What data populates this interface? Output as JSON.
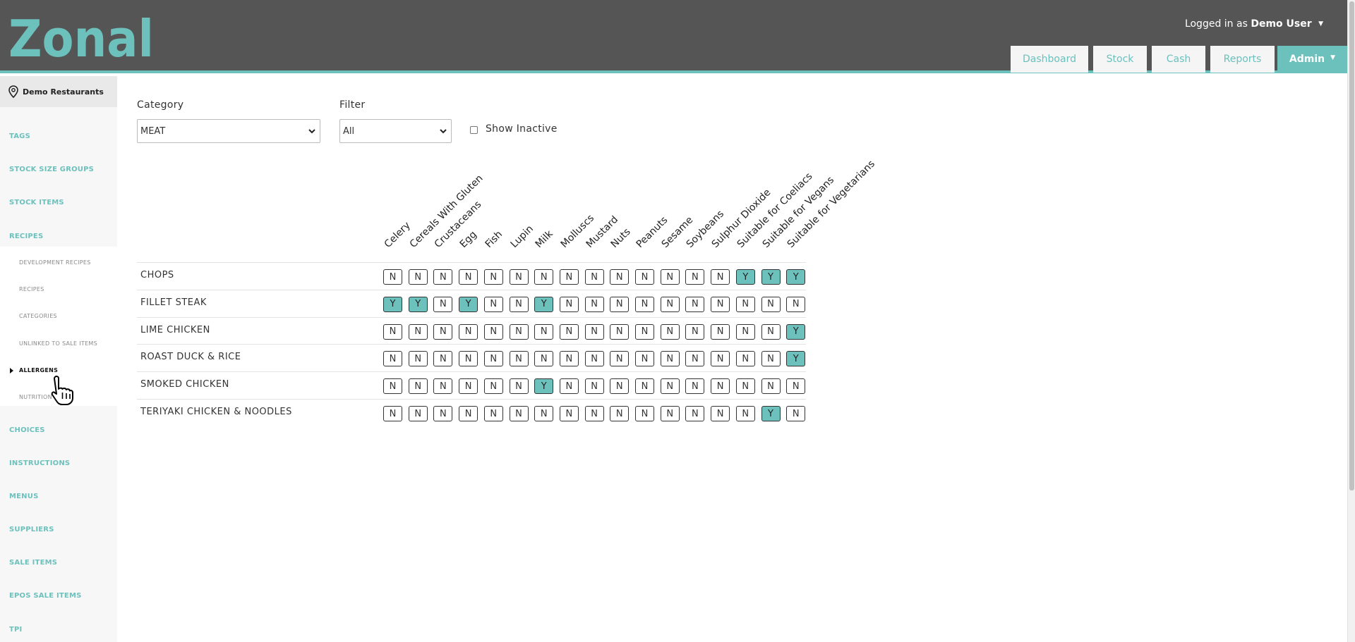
{
  "header": {
    "logo_text": "Zonal",
    "user_prefix": "Logged in as",
    "user_name": "Demo User",
    "nav": [
      {
        "label": "Dashboard"
      },
      {
        "label": "Stock"
      },
      {
        "label": "Cash"
      },
      {
        "label": "Reports"
      },
      {
        "label": "Admin"
      }
    ]
  },
  "sidebar": {
    "site": "Demo Restaurants",
    "items": [
      "TAGS",
      "STOCK SIZE GROUPS",
      "STOCK ITEMS",
      "RECIPES",
      "CHOICES",
      "INSTRUCTIONS",
      "MENUS",
      "SUPPLIERS",
      "SALE ITEMS",
      "EPOS SALE ITEMS",
      "TPI"
    ],
    "recipes_sub": [
      "DEVELOPMENT RECIPES",
      "RECIPES",
      "CATEGORIES",
      "UNLINKED TO SALE ITEMS",
      "ALLERGENS",
      "NUTRITION"
    ],
    "active_sub": "ALLERGENS"
  },
  "filters": {
    "category_label": "Category",
    "category_value": "MEAT",
    "filter_label": "Filter",
    "filter_value": "All",
    "show_inactive_label": "Show Inactive"
  },
  "allergens": {
    "columns": [
      "Celery",
      "Cereals With Gluten",
      "Crustaceans",
      "Egg",
      "Fish",
      "Lupin",
      "Milk",
      "Molluscs",
      "Mustard",
      "Nuts",
      "Peanuts",
      "Sesame",
      "Soybeans",
      "Sulphur Dioxide",
      "Suitable for Coeliacs",
      "Suitable for Vegans",
      "Suitable for Vegetarians"
    ],
    "rows": [
      {
        "name": "CHOPS",
        "values": [
          "N",
          "N",
          "N",
          "N",
          "N",
          "N",
          "N",
          "N",
          "N",
          "N",
          "N",
          "N",
          "N",
          "N",
          "Y",
          "Y",
          "Y"
        ]
      },
      {
        "name": "FILLET STEAK",
        "values": [
          "Y",
          "Y",
          "N",
          "Y",
          "N",
          "N",
          "Y",
          "N",
          "N",
          "N",
          "N",
          "N",
          "N",
          "N",
          "N",
          "N",
          "N"
        ]
      },
      {
        "name": "LIME CHICKEN",
        "values": [
          "N",
          "N",
          "N",
          "N",
          "N",
          "N",
          "N",
          "N",
          "N",
          "N",
          "N",
          "N",
          "N",
          "N",
          "N",
          "N",
          "Y"
        ]
      },
      {
        "name": "ROAST DUCK & RICE",
        "values": [
          "N",
          "N",
          "N",
          "N",
          "N",
          "N",
          "N",
          "N",
          "N",
          "N",
          "N",
          "N",
          "N",
          "N",
          "N",
          "N",
          "Y"
        ]
      },
      {
        "name": "SMOKED CHICKEN",
        "values": [
          "N",
          "N",
          "N",
          "N",
          "N",
          "N",
          "Y",
          "N",
          "N",
          "N",
          "N",
          "N",
          "N",
          "N",
          "N",
          "N",
          "N"
        ]
      },
      {
        "name": "TERIYAKI CHICKEN & NOODLES",
        "values": [
          "N",
          "N",
          "N",
          "N",
          "N",
          "N",
          "N",
          "N",
          "N",
          "N",
          "N",
          "N",
          "N",
          "N",
          "N",
          "Y",
          "N"
        ]
      }
    ]
  },
  "colors": {
    "accent": "#6cc1bd",
    "header": "#555555"
  }
}
